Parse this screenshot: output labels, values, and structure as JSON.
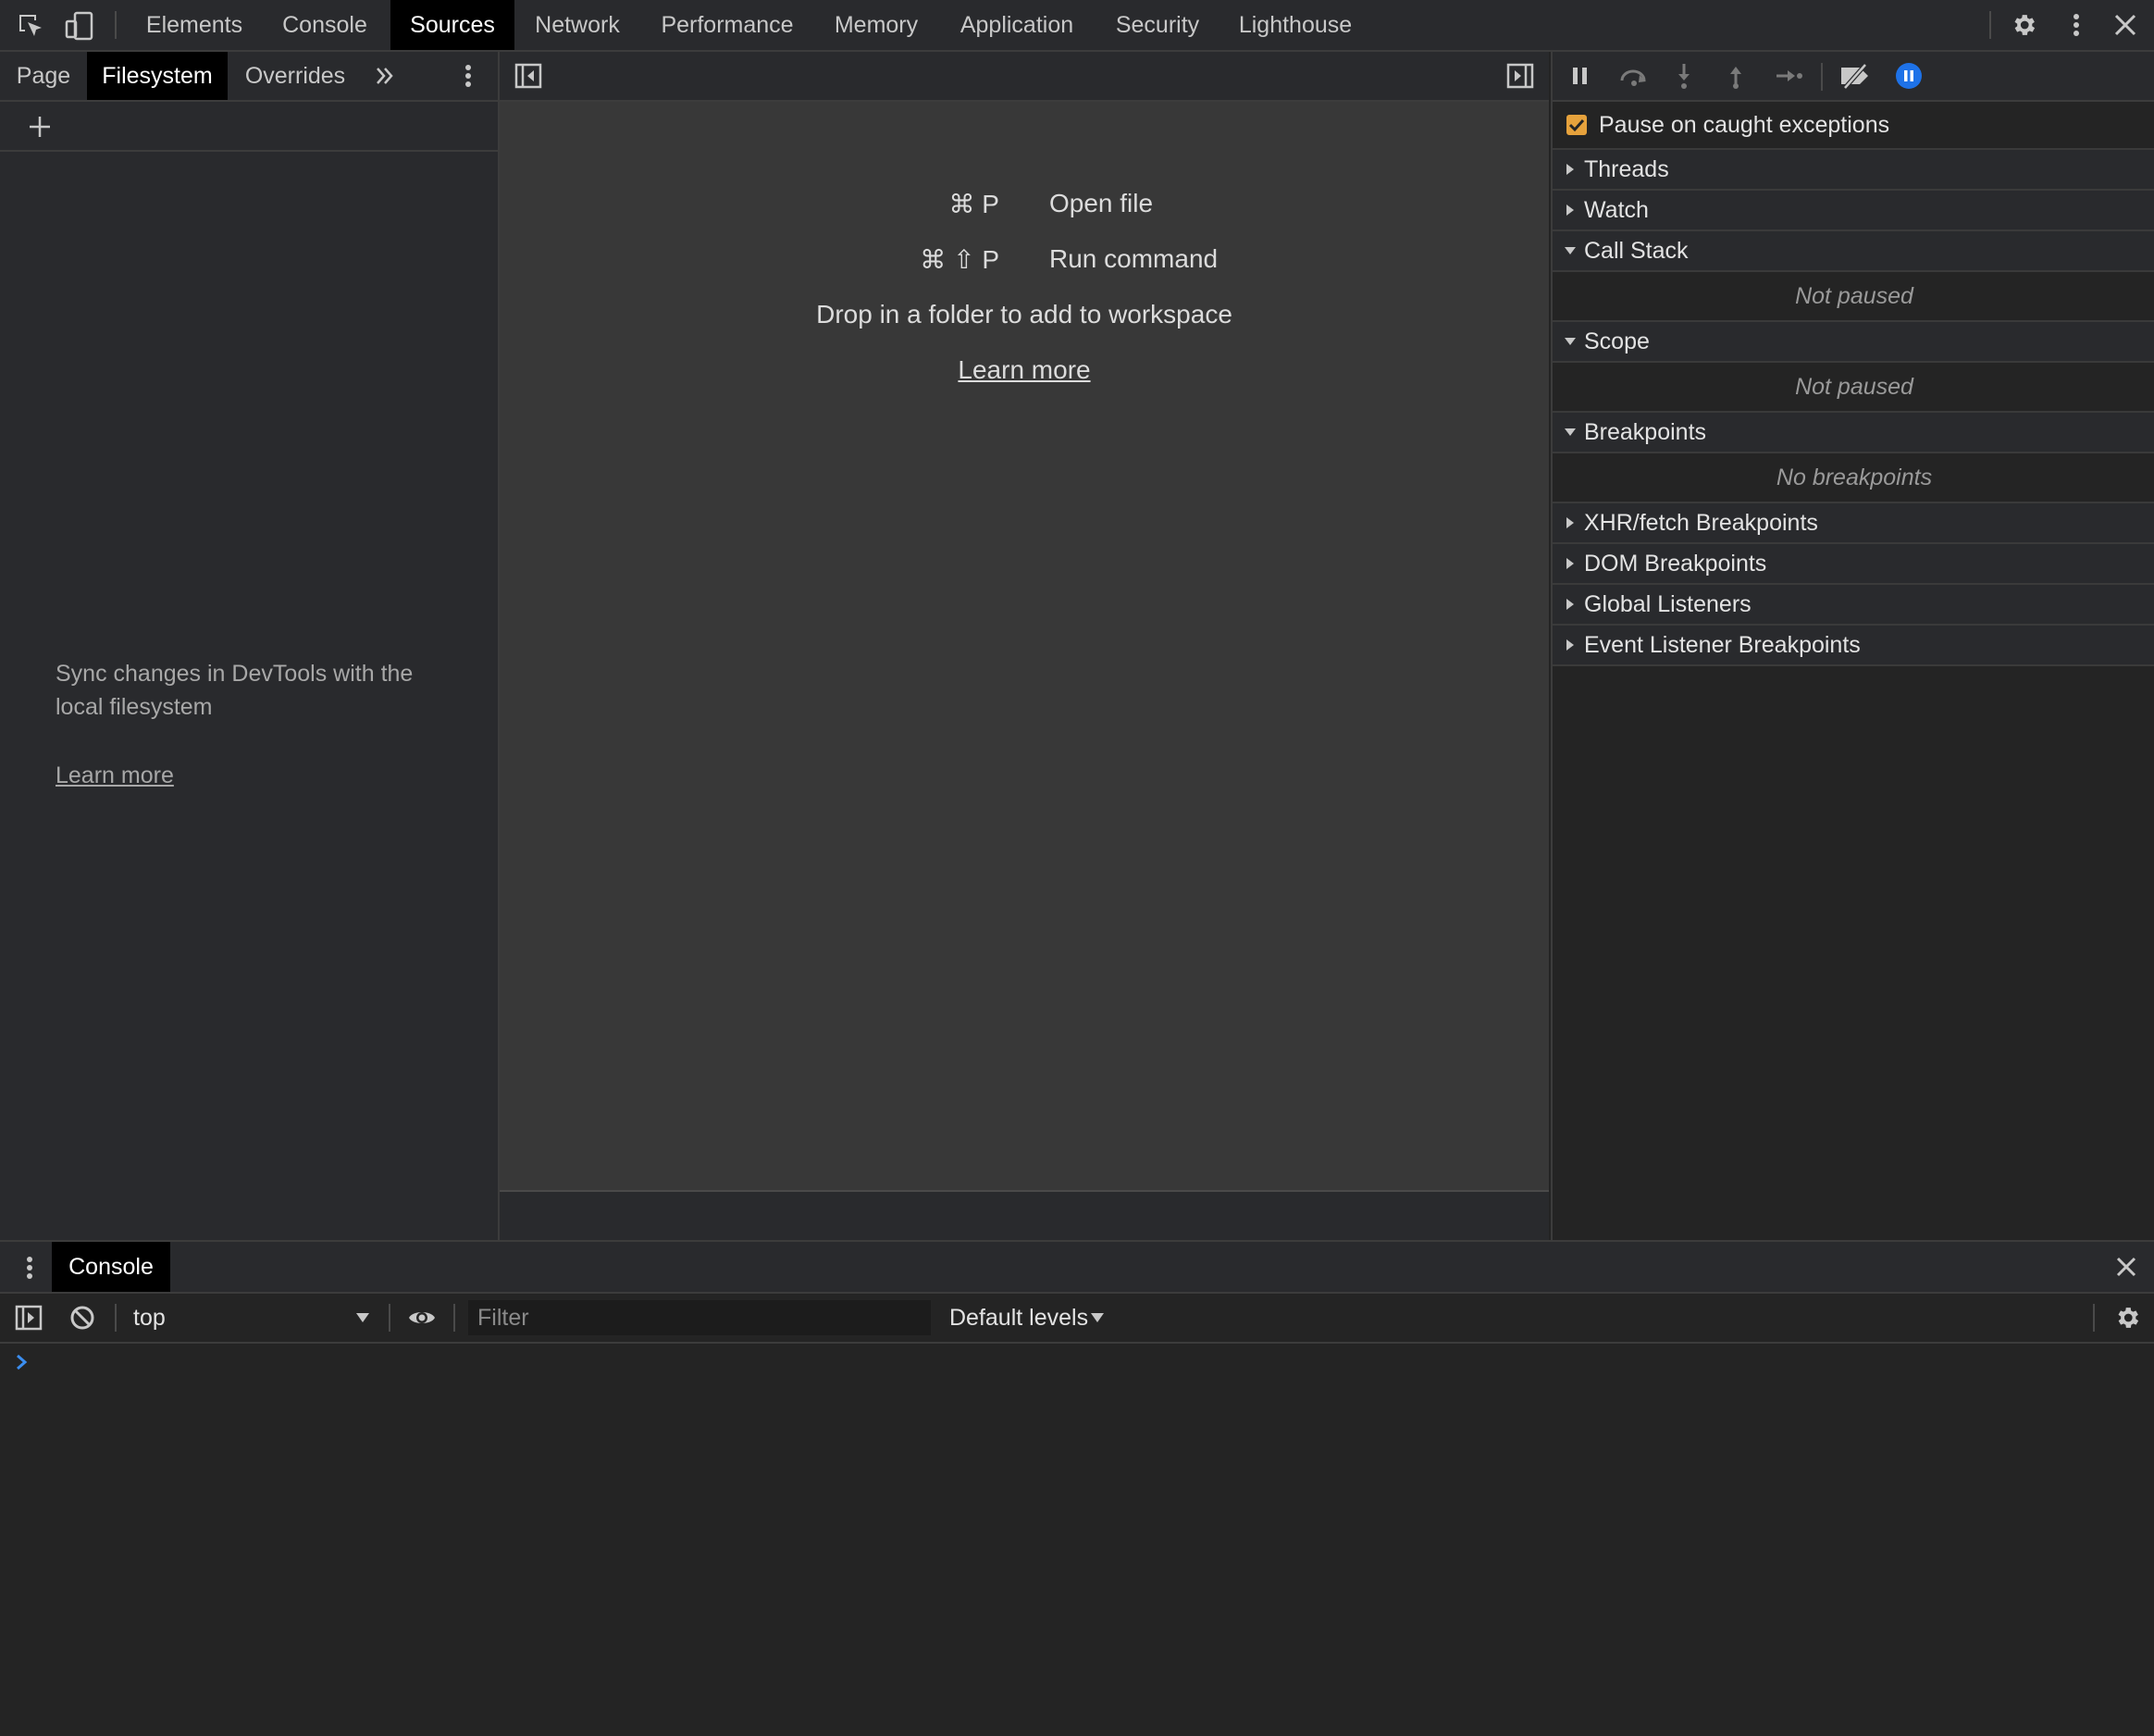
{
  "colors": {
    "accent_checkbox": "#e6a23c",
    "breakpoint_toggle": "#1e72e8",
    "prompt_arrow": "#3b8ef0"
  },
  "toolbar": {
    "icons": [
      "inspect-element-icon",
      "device-toolbar-icon",
      "settings-icon",
      "more-options-icon",
      "close-icon"
    ],
    "tabs": [
      "Elements",
      "Console",
      "Sources",
      "Network",
      "Performance",
      "Memory",
      "Application",
      "Security",
      "Lighthouse"
    ],
    "active_tab": "Sources"
  },
  "navigator": {
    "tabs": [
      "Page",
      "Filesystem",
      "Overrides"
    ],
    "active_tab": "Filesystem",
    "more_tabs_icon": "double-chevron-icon",
    "add_folder_icon": "plus-icon",
    "message_line1": "Sync changes in DevTools with the",
    "message_line2": "local filesystem",
    "learn_more": "Learn more"
  },
  "editor": {
    "hints": [
      {
        "shortcut": "⌘ P",
        "action": "Open file"
      },
      {
        "shortcut": "⌘ ⇧ P",
        "action": "Run command"
      }
    ],
    "drop_message": "Drop in a folder to add to workspace",
    "learn_more": "Learn more"
  },
  "debugger": {
    "pause_on_caught": {
      "label": "Pause on caught exceptions",
      "checked": true
    },
    "sections": {
      "threads": "Threads",
      "watch": "Watch",
      "call_stack": "Call Stack",
      "call_stack_status": "Not paused",
      "scope": "Scope",
      "scope_status": "Not paused",
      "breakpoints": "Breakpoints",
      "breakpoints_status": "No breakpoints",
      "xhr": "XHR/fetch Breakpoints",
      "dom": "DOM Breakpoints",
      "global": "Global Listeners",
      "event": "Event Listener Breakpoints"
    }
  },
  "drawer": {
    "tab": "Console",
    "context": "top",
    "filter_placeholder": "Filter",
    "levels": "Default levels"
  }
}
